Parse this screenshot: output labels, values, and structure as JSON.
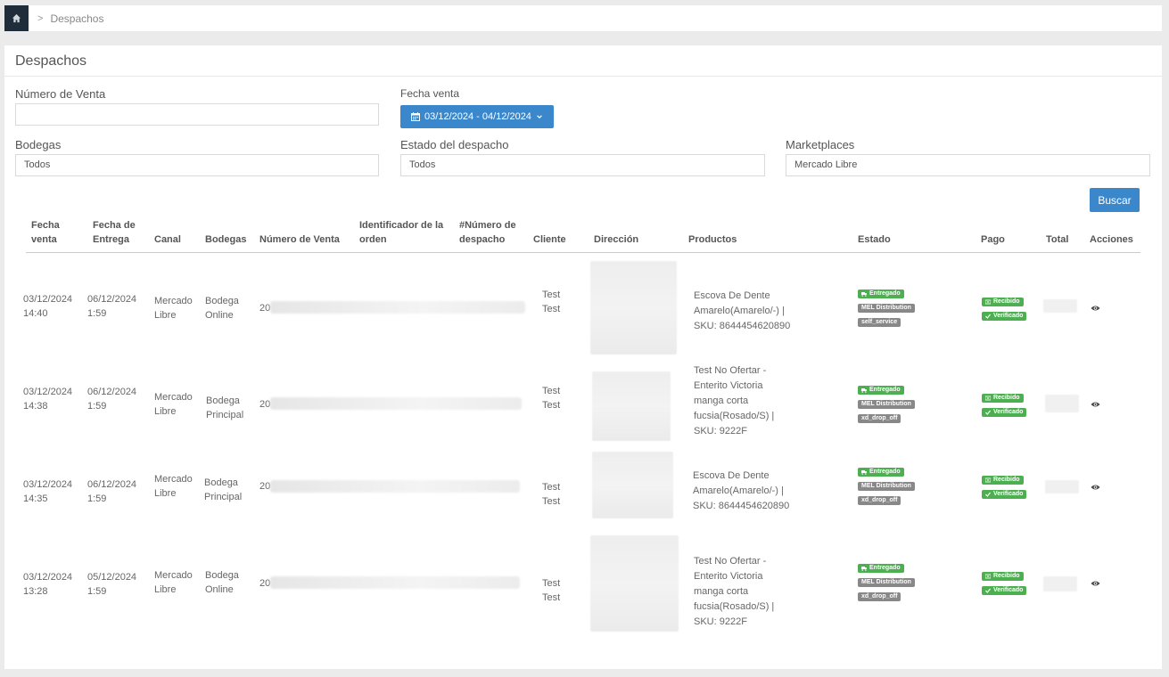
{
  "breadcrumb": {
    "current": "Despachos",
    "separator": ">"
  },
  "panel": {
    "title": "Despachos"
  },
  "filters": {
    "numero_venta": {
      "label": "Número de Venta",
      "value": ""
    },
    "fecha_venta": {
      "label": "Fecha venta",
      "range": "03/12/2024 - 04/12/2024"
    },
    "bodegas": {
      "label": "Bodegas",
      "value": "Todos"
    },
    "estado": {
      "label": "Estado del despacho",
      "value": "Todos"
    },
    "marketplaces": {
      "label": "Marketplaces",
      "value": "Mercado Libre"
    },
    "search_label": "Buscar"
  },
  "table": {
    "headers": {
      "fecha_venta": [
        "Fecha",
        "venta"
      ],
      "fecha_entrega": [
        "Fecha de",
        "Entrega"
      ],
      "canal": "Canal",
      "bodegas": "Bodegas",
      "numero_venta": "Número de Venta",
      "identificador": [
        "Identificador de la",
        "orden"
      ],
      "numero_despacho": [
        "#Número de",
        "despacho"
      ],
      "cliente": "Cliente",
      "direccion": "Dirección",
      "productos": "Productos",
      "estado": "Estado",
      "pago": "Pago",
      "total": "Total",
      "acciones": "Acciones"
    },
    "rows": [
      {
        "fecha_venta": [
          "03/12/2024",
          "14:40"
        ],
        "fecha_entrega": [
          "06/12/2024",
          "1:59"
        ],
        "canal": [
          "Mercado",
          "Libre"
        ],
        "bodega": [
          "Bodega",
          "Online"
        ],
        "numero_venta": "20",
        "cliente": [
          "Test",
          "Test"
        ],
        "producto": [
          "Escova De Dente",
          "Amarelo(Amarelo/-) |",
          "SKU: 8644454620890"
        ],
        "estado": [
          "Entregado",
          "MEL Distribution",
          "self_service"
        ],
        "pago": [
          "Recibido",
          "Verificado"
        ]
      },
      {
        "fecha_venta": [
          "03/12/2024",
          "14:38"
        ],
        "fecha_entrega": [
          "06/12/2024",
          "1:59"
        ],
        "canal": [
          "Mercado",
          "Libre"
        ],
        "bodega": [
          "Bodega",
          "Principal"
        ],
        "numero_venta": "20",
        "cliente": [
          "Test",
          "Test"
        ],
        "producto": [
          "Test No Ofertar -",
          "Enterito Victoria",
          "manga corta",
          "fucsia(Rosado/S) |",
          "SKU: 9222F"
        ],
        "estado": [
          "Entregado",
          "MEL Distribution",
          "xd_drop_off"
        ],
        "pago": [
          "Recibido",
          "Verificado"
        ]
      },
      {
        "fecha_venta": [
          "03/12/2024",
          "14:35"
        ],
        "fecha_entrega": [
          "06/12/2024",
          "1:59"
        ],
        "canal": [
          "Mercado",
          "Libre"
        ],
        "bodega": [
          "Bodega",
          "Principal"
        ],
        "numero_venta": "20",
        "cliente": [
          "Test",
          "Test"
        ],
        "producto": [
          "Escova De Dente",
          "Amarelo(Amarelo/-) |",
          "SKU: 8644454620890"
        ],
        "estado": [
          "Entregado",
          "MEL Distribution",
          "xd_drop_off"
        ],
        "pago": [
          "Recibido",
          "Verificado"
        ]
      },
      {
        "fecha_venta": [
          "03/12/2024",
          "13:28"
        ],
        "fecha_entrega": [
          "05/12/2024",
          "1:59"
        ],
        "canal": [
          "Mercado",
          "Libre"
        ],
        "bodega": [
          "Bodega",
          "Online"
        ],
        "numero_venta": "20",
        "cliente": [
          "Test",
          "Test"
        ],
        "producto": [
          "Test No Ofertar -",
          "Enterito Victoria",
          "manga corta",
          "fucsia(Rosado/S) |",
          "SKU: 9222F"
        ],
        "estado": [
          "Entregado",
          "MEL Distribution",
          "xd_drop_off"
        ],
        "pago": [
          "Recibido",
          "Verificado"
        ]
      }
    ]
  },
  "colors": {
    "primary": "#3a87cc",
    "success": "#4caf50",
    "muted": "#888888",
    "dark": "#1f2d3a"
  },
  "icons": [
    "home-icon",
    "calendar-icon",
    "chevron-down-icon",
    "truck-icon",
    "money-icon",
    "check-icon",
    "eye-icon"
  ]
}
